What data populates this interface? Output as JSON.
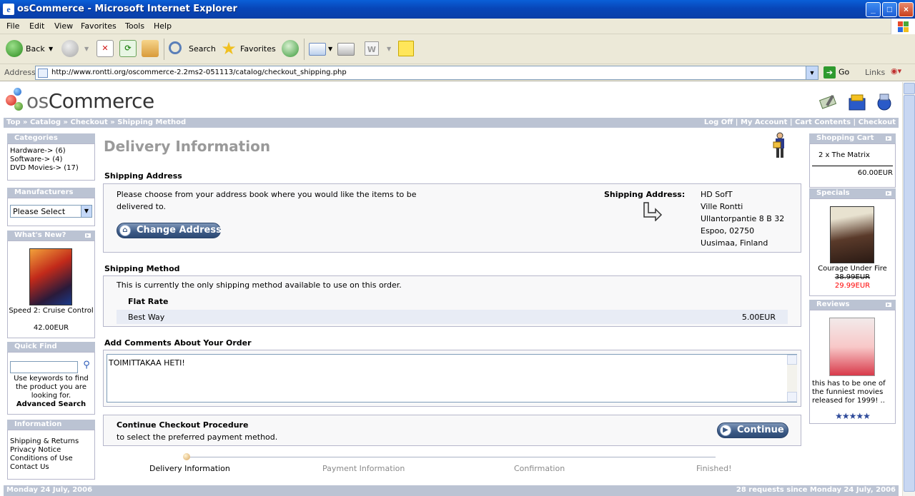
{
  "window": {
    "title": "osCommerce - Microsoft Internet Explorer",
    "controls": {
      "minimize": "_",
      "maximize": "□",
      "close": "×"
    }
  },
  "menu": [
    "File",
    "Edit",
    "View",
    "Favorites",
    "Tools",
    "Help"
  ],
  "toolbar": {
    "back_label": "Back",
    "search_label": "Search",
    "favorites_label": "Favorites"
  },
  "address": {
    "label": "Address",
    "url": "http://www.rontti.org/oscommerce-2.2ms2-051113/catalog/checkout_shipping.php",
    "go_label": "Go",
    "links_label": "Links"
  },
  "logo": {
    "prefix": "os",
    "suffix": "Commerce"
  },
  "breadcrumb": [
    "Top",
    "Catalog",
    "Checkout",
    "Shipping Method"
  ],
  "breadcrumb_sep": " » ",
  "header_links": [
    "Log Off",
    "My Account",
    "Cart Contents",
    "Checkout"
  ],
  "header_links_sep": " | ",
  "left": {
    "categories": {
      "title": "Categories",
      "items": [
        "Hardware-> (6)",
        "Software-> (4)",
        "DVD Movies-> (17)"
      ]
    },
    "manufacturers": {
      "title": "Manufacturers",
      "selected": "Please Select"
    },
    "whats_new": {
      "title": "What's New?",
      "product": "Speed 2: Cruise Control",
      "price": "42.00EUR"
    },
    "quick_find": {
      "title": "Quick Find",
      "hint": "Use keywords to find the product you are looking for.",
      "advanced": "Advanced Search"
    },
    "information": {
      "title": "Information",
      "items": [
        "Shipping & Returns",
        "Privacy Notice",
        "Conditions of Use",
        "Contact Us"
      ]
    }
  },
  "main": {
    "heading": "Delivery Information",
    "shipping_address": {
      "section_title": "Shipping Address",
      "instruction": "Please choose from your address book where you would like the items to be delivered to.",
      "button": "Change Address",
      "address_label": "Shipping Address:",
      "address_lines": [
        "HD SofT",
        "Ville Rontti",
        "Ullantorpantie 8 B 32",
        "Espoo, 02750",
        "Uusimaa, Finland"
      ]
    },
    "shipping_method": {
      "section_title": "Shipping Method",
      "note": "This is currently the only shipping method available to use on this order.",
      "method_title": "Flat Rate",
      "option_name": "Best Way",
      "option_price": "5.00EUR"
    },
    "comments": {
      "section_title": "Add Comments About Your Order",
      "value": "TOIMITTAKAA HETI!"
    },
    "continue": {
      "title": "Continue Checkout Procedure",
      "subtitle": "to select the preferred payment method.",
      "button": "Continue"
    },
    "progress": {
      "steps": [
        "Delivery Information",
        "Payment Information",
        "Confirmation",
        "Finished!"
      ],
      "current_index": 0
    }
  },
  "right": {
    "cart": {
      "title": "Shopping Cart",
      "item": "2 x The Matrix",
      "total": "60.00EUR"
    },
    "specials": {
      "title": "Specials",
      "product": "Courage Under Fire",
      "old_price": "38.99EUR",
      "new_price": "29.99EUR"
    },
    "reviews": {
      "title": "Reviews",
      "text": "this has to be one of the funniest movies released for 1999! ..",
      "rating": 5
    }
  },
  "footer": {
    "date": "Monday 24 July, 2006",
    "requests": "28 requests since Monday 24 July, 2006"
  },
  "colors": {
    "box_header": "#bbc3d3",
    "box_border": "#b6b7cb",
    "special_price": "#ff0000",
    "heading_gray": "#9a9a9a"
  }
}
